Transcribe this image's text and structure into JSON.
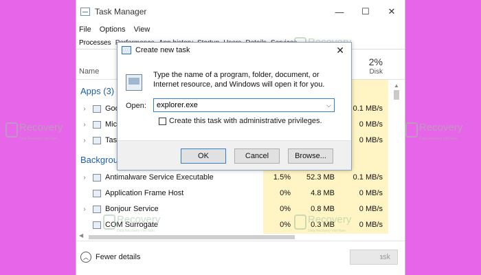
{
  "window": {
    "title": "Task Manager",
    "controls": [
      "—",
      "☐",
      "✕"
    ]
  },
  "menu": [
    "File",
    "Options",
    "View"
  ],
  "tabs": [
    "Processes",
    "Performance",
    "App history",
    "Startup",
    "Users",
    "Details",
    "Services"
  ],
  "columns": {
    "name": "Name",
    "disk_pct": "2%",
    "disk": "Disk"
  },
  "apps_group": "Apps (3)",
  "apps": [
    {
      "name": "Goog",
      "disk": "0.1 MB/s"
    },
    {
      "name": "Micr",
      "disk": "0 MB/s"
    },
    {
      "name": "Task",
      "disk": "0 MB/s"
    }
  ],
  "background_group": "Backgrou",
  "processes": [
    {
      "name": "Antimalware Service Executable",
      "cpu": "1.5%",
      "memory": "52.3 MB",
      "disk": "0.1 MB/s"
    },
    {
      "name": "Application Frame Host",
      "cpu": "0%",
      "memory": "4.8 MB",
      "disk": "0 MB/s"
    },
    {
      "name": "Bonjour Service",
      "cpu": "0%",
      "memory": "0.8 MB",
      "disk": "0 MB/s"
    },
    {
      "name": "COM Surrogate",
      "cpu": "0%",
      "memory": "0.3 MB",
      "disk": "0 MB/s"
    }
  ],
  "footer": {
    "fewer_details": "Fewer details",
    "end_task": "End task"
  },
  "dialog": {
    "title": "Create new task",
    "description": "Type the name of a program, folder, document, or Internet resource, and Windows will open it for you.",
    "open_label": "Open:",
    "open_value": "explorer.exe",
    "checkbox_label": "Create this task with administrative privileges.",
    "ok": "OK",
    "cancel": "Cancel",
    "browse": "Browse..."
  },
  "watermark": {
    "brand": "Recovery",
    "tagline": "Data Recovery Viet Nam"
  }
}
